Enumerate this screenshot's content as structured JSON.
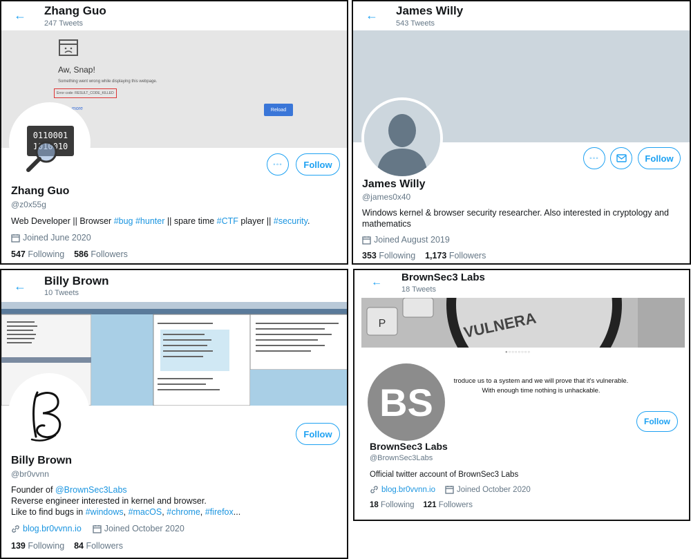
{
  "p1": {
    "header_name": "Zhang Guo",
    "header_count": "247 Tweets",
    "banner": {
      "title": "Aw, Snap!",
      "message": "Something went wrong while displaying this webpage.",
      "error": "Error code: RESULT_CODE_KILLED",
      "learn": "more",
      "reload": "Reload"
    },
    "name": "Zhang Guo",
    "handle": "@z0x55g",
    "bio": [
      "Web Developer || Browser ",
      "#bug",
      " ",
      "#hunter",
      " || spare time ",
      "#CTF",
      " player || ",
      "#security",
      "."
    ],
    "joined": "Joined June 2020",
    "following_n": "547",
    "following": "Following",
    "followers_n": "586",
    "followers": "Followers",
    "follow": "Follow"
  },
  "p2": {
    "header_name": "James Willy",
    "header_count": "543 Tweets",
    "name": "James Willy",
    "handle": "@james0x40",
    "bio": "Windows kernel & browser security researcher. Also interested in cryptology and mathematics",
    "joined": "Joined August 2019",
    "following_n": "353",
    "following": "Following",
    "followers_n": "1,173",
    "followers": "Followers",
    "follow": "Follow"
  },
  "p3": {
    "header_name": "Billy Brown",
    "header_count": "10 Tweets",
    "name": "Billy Brown",
    "handle": "@br0vvnn",
    "bio1_a": "Founder of ",
    "bio1_b": "@BrownSec3Labs",
    "bio2": "Reverse engineer interested in kernel and browser.",
    "bio3_a": "Like to find bugs in ",
    "bio3_b": "#windows",
    "bio3_c": ", ",
    "bio3_d": "#macOS",
    "bio3_e": ", ",
    "bio3_f": "#chrome",
    "bio3_g": ", ",
    "bio3_h": "#firefox",
    "bio3_i": "...",
    "website": "blog.br0vvnn.io",
    "joined": "Joined October 2020",
    "following_n": "139",
    "following": "Following",
    "followers_n": "84",
    "followers": "Followers",
    "follow": "Follow"
  },
  "p4": {
    "header_name": "BrownSec3 Labs",
    "header_count": "18 Tweets",
    "banner_word": "VULNERA",
    "tagline1": "troduce us to a system and we will prove that it's vulnerable.",
    "tagline2": "With enough time nothing is unhackable.",
    "avatar_text": "BS",
    "name": "BrownSec3 Labs",
    "handle": "@BrownSec3Labs",
    "bio": "Official twitter account of BrownSec3 Labs",
    "website": "blog.br0vvnn.io",
    "joined": "Joined October 2020",
    "following_n": "18",
    "following": "Following",
    "followers_n": "121",
    "followers": "Followers",
    "follow": "Follow"
  },
  "icons": {
    "back": "back-arrow-icon",
    "more": "more-icon",
    "message": "message-icon",
    "calendar": "calendar-icon",
    "link": "link-icon"
  },
  "colors": {
    "accent": "#1da1f2",
    "link": "#1b95e0",
    "muted": "#657786",
    "banner_gray": "#ccd6dd"
  }
}
